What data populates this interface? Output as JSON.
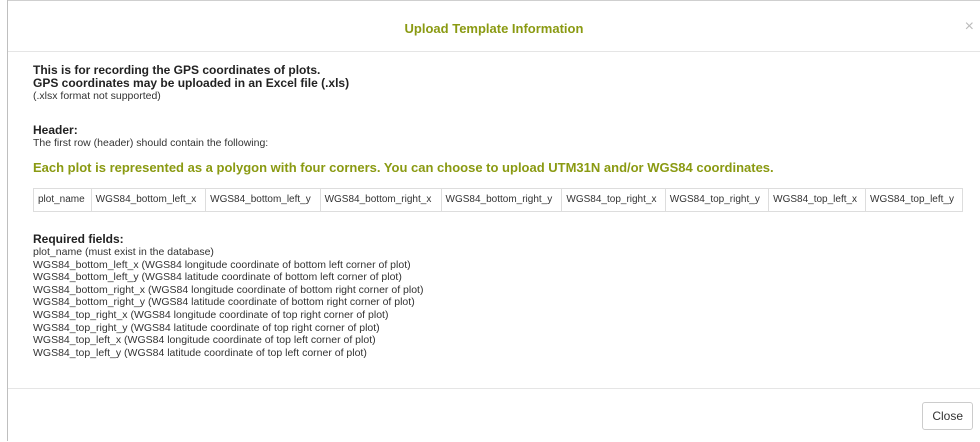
{
  "modal": {
    "title": "Upload Template Information",
    "close_icon": "×"
  },
  "intro": {
    "line1": "This is for recording the GPS coordinates of plots.",
    "line2": "GPS coordinates may be uploaded in an Excel file (.xls)",
    "note": "(.xlsx format not supported)"
  },
  "header_section": {
    "title": "Header:",
    "description": "The first row (header) should contain the following:"
  },
  "highlight": "Each plot is represented as a polygon with four corners. You can choose to upload UTM31N and/or WGS84 coordinates.",
  "columns": [
    "plot_name",
    "WGS84_bottom_left_x",
    "WGS84_bottom_left_y",
    "WGS84_bottom_right_x",
    "WGS84_bottom_right_y",
    "WGS84_top_right_x",
    "WGS84_top_right_y",
    "WGS84_top_left_x",
    "WGS84_top_left_y"
  ],
  "required": {
    "title": "Required fields:",
    "fields": [
      "plot_name (must exist in the database)",
      "WGS84_bottom_left_x (WGS84 longitude coordinate of bottom left corner of plot)",
      "WGS84_bottom_left_y (WGS84 latitude coordinate of bottom left corner of plot)",
      "WGS84_bottom_right_x (WGS84 longitude coordinate of bottom right corner of plot)",
      "WGS84_bottom_right_y (WGS84 latitude coordinate of bottom right corner of plot)",
      "WGS84_top_right_x (WGS84 longitude coordinate of top right corner of plot)",
      "WGS84_top_right_y (WGS84 latitude coordinate of top right corner of plot)",
      "WGS84_top_left_x (WGS84 longitude coordinate of top left corner of plot)",
      "WGS84_top_left_y (WGS84 latitude coordinate of top left corner of plot)"
    ]
  },
  "footer": {
    "close_label": "Close"
  },
  "colors": {
    "accent": "#8a9a12"
  }
}
